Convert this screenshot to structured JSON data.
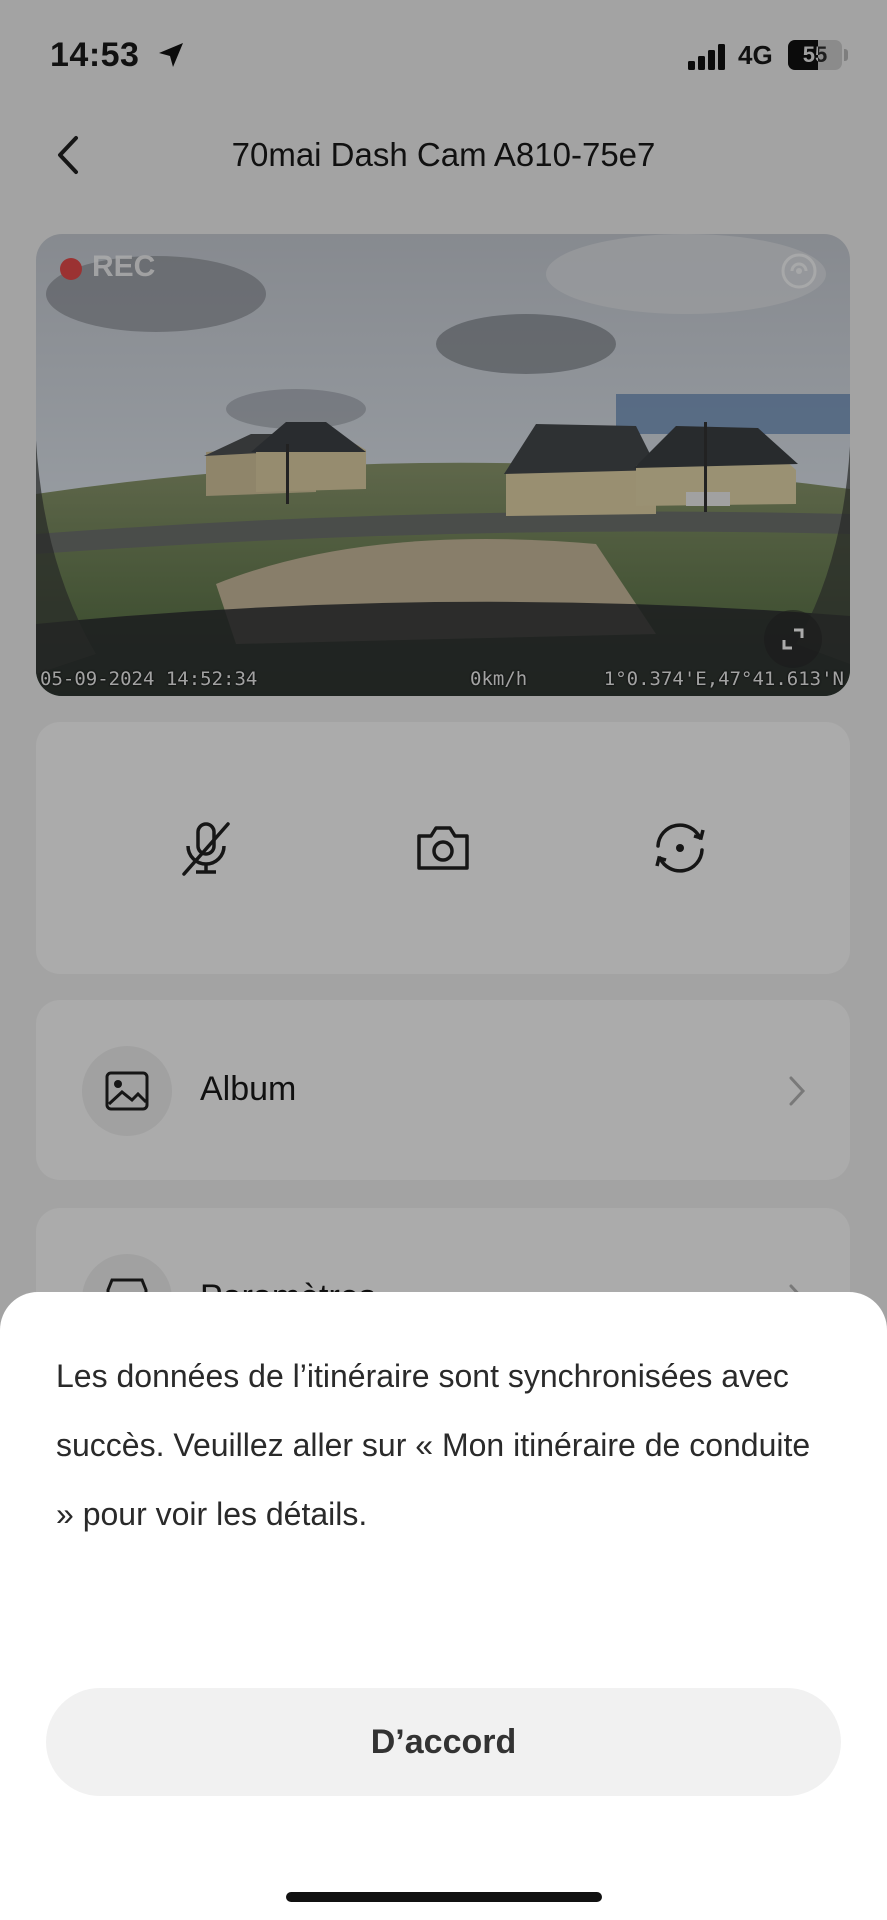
{
  "status_bar": {
    "time": "14:53",
    "network": "4G",
    "battery": "55",
    "battery_level": 0.55
  },
  "header": {
    "title": "70mai Dash Cam A810-75e7"
  },
  "preview": {
    "rec_label": "REC",
    "date_time": "05-09-2024 14:52:34",
    "speed": "0km/h",
    "coordinates": "1°0.374'E,47°41.613'N"
  },
  "controls": {
    "items": [
      {
        "name": "microphone-muted-icon"
      },
      {
        "name": "camera-icon"
      },
      {
        "name": "switch-camera-icon"
      }
    ]
  },
  "menu": {
    "items": [
      {
        "label": "Album",
        "icon": "image-icon"
      },
      {
        "label": "Paramètres",
        "icon": "settings-icon"
      }
    ]
  },
  "dialog": {
    "message": "Les données de l’itinéraire sont synchronisées avec succès. Veuillez aller sur « Mon itinéraire de conduite » pour voir les détails.",
    "button_label": "D’accord"
  },
  "colors": {
    "rec_dot": "#e84b4b",
    "sheet_bg": "#ffffff",
    "button_bg": "#f1f1f1"
  }
}
